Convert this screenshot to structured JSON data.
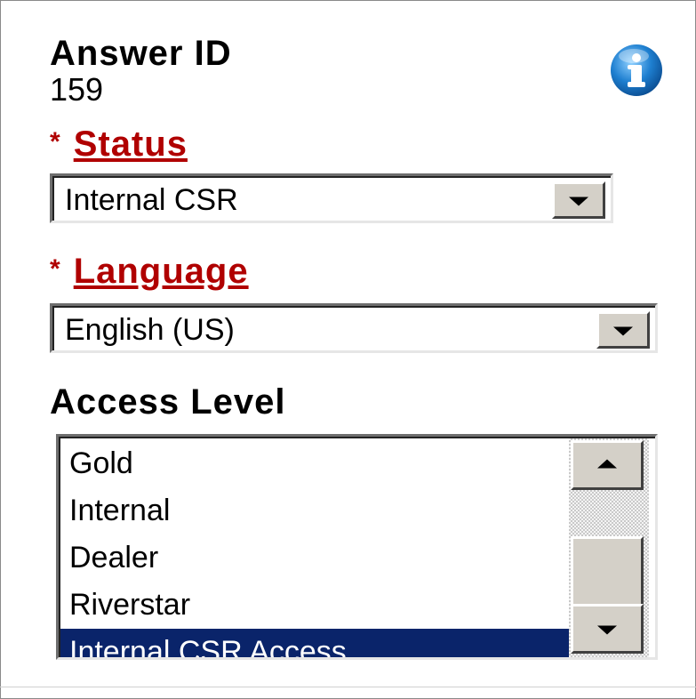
{
  "answer_id": {
    "label": "Answer ID",
    "value": "159"
  },
  "info_icon": {
    "icon": "info-icon",
    "color": "#1e7fd0"
  },
  "status": {
    "required_marker": "*",
    "label": "Status",
    "label_color": "#b00000",
    "selected": "Internal CSR"
  },
  "language": {
    "required_marker": "*",
    "label": "Language",
    "label_color": "#b00000",
    "selected": "English (US)"
  },
  "access_level": {
    "label": "Access Level",
    "options": [
      "Gold",
      "Internal",
      "Dealer",
      "Riverstar",
      "Internal CSR Access"
    ],
    "selected": "Internal CSR Access",
    "selected_color": "#0a246a"
  }
}
